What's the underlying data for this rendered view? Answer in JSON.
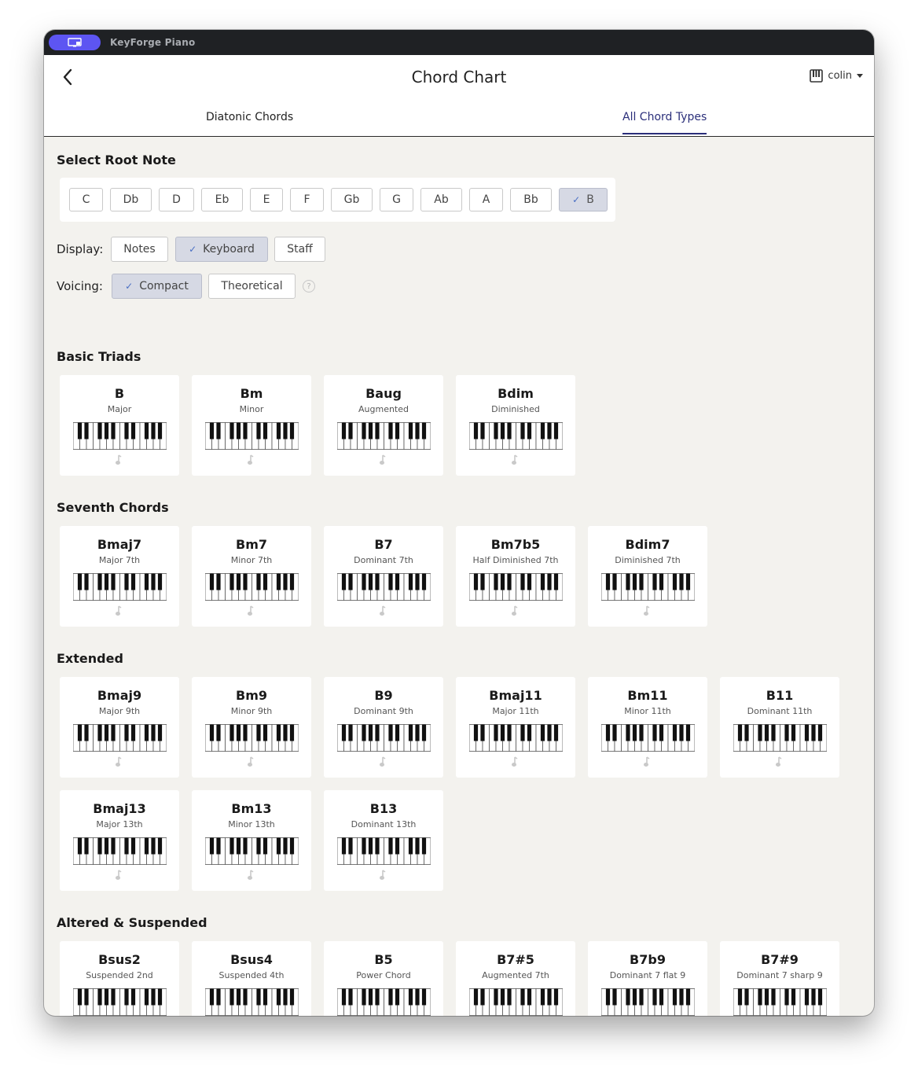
{
  "app": {
    "name": "KeyForge Piano"
  },
  "header": {
    "title": "Chord Chart",
    "user": "colin"
  },
  "tabs": [
    {
      "label": "Diatonic Chords",
      "active": false
    },
    {
      "label": "All Chord Types",
      "active": true
    }
  ],
  "root_section": {
    "title": "Select Root Note",
    "notes": [
      "C",
      "Db",
      "D",
      "Eb",
      "E",
      "F",
      "Gb",
      "G",
      "Ab",
      "A",
      "Bb",
      "B"
    ],
    "selected": "B"
  },
  "display": {
    "label": "Display:",
    "options": [
      "Notes",
      "Keyboard",
      "Staff"
    ],
    "selected": "Keyboard"
  },
  "voicing": {
    "label": "Voicing:",
    "options": [
      "Compact",
      "Theoretical"
    ],
    "selected": "Compact"
  },
  "colors": {
    "accent": "#2b2f7a",
    "key_highlight": "#4a8ad8",
    "selected_bg": "#d6d9e4"
  },
  "sections": [
    {
      "title": "Basic Triads",
      "chords": [
        {
          "name": "B",
          "quality": "Major"
        },
        {
          "name": "Bm",
          "quality": "Minor"
        },
        {
          "name": "Baug",
          "quality": "Augmented"
        },
        {
          "name": "Bdim",
          "quality": "Diminished"
        }
      ]
    },
    {
      "title": "Seventh Chords",
      "chords": [
        {
          "name": "Bmaj7",
          "quality": "Major 7th"
        },
        {
          "name": "Bm7",
          "quality": "Minor 7th"
        },
        {
          "name": "B7",
          "quality": "Dominant 7th"
        },
        {
          "name": "Bm7b5",
          "quality": "Half Diminished 7th"
        },
        {
          "name": "Bdim7",
          "quality": "Diminished 7th"
        }
      ]
    },
    {
      "title": "Extended",
      "chords": [
        {
          "name": "Bmaj9",
          "quality": "Major 9th"
        },
        {
          "name": "Bm9",
          "quality": "Minor 9th"
        },
        {
          "name": "B9",
          "quality": "Dominant 9th"
        },
        {
          "name": "Bmaj11",
          "quality": "Major 11th"
        },
        {
          "name": "Bm11",
          "quality": "Minor 11th"
        },
        {
          "name": "B11",
          "quality": "Dominant 11th"
        },
        {
          "name": "Bmaj13",
          "quality": "Major 13th"
        },
        {
          "name": "Bm13",
          "quality": "Minor 13th"
        },
        {
          "name": "B13",
          "quality": "Dominant 13th"
        }
      ]
    },
    {
      "title": "Altered & Suspended",
      "chords": [
        {
          "name": "Bsus2",
          "quality": "Suspended 2nd"
        },
        {
          "name": "Bsus4",
          "quality": "Suspended 4th"
        },
        {
          "name": "B5",
          "quality": "Power Chord"
        },
        {
          "name": "B7#5",
          "quality": "Augmented 7th"
        },
        {
          "name": "B7b9",
          "quality": "Dominant 7 flat 9"
        },
        {
          "name": "B7#9",
          "quality": "Dominant 7 sharp 9"
        }
      ]
    }
  ]
}
